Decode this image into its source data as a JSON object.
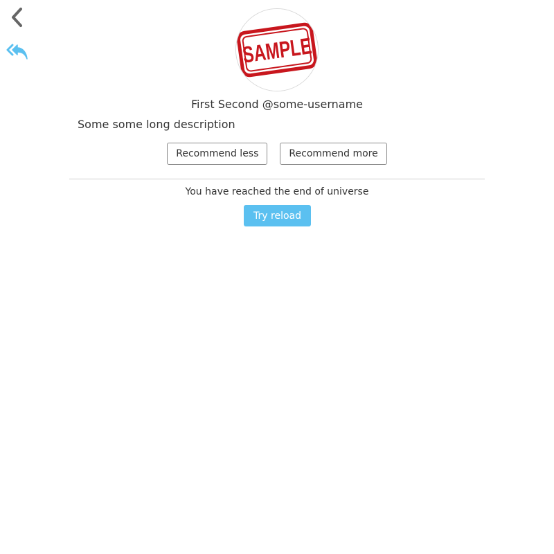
{
  "nav": {
    "back_icon": "chevron-left-icon",
    "reply_all_icon": "reply-all-icon",
    "accent_color": "#5bc0f0"
  },
  "profile": {
    "avatar_stamp_text": "SAMPLE",
    "name_line": "First Second @some-username",
    "description": "Some some long description"
  },
  "actions": {
    "recommend_less_label": "Recommend less",
    "recommend_more_label": "Recommend more"
  },
  "feed_end": {
    "message": "You have reached the end of universe",
    "reload_label": "Try reload",
    "reload_color": "#5bc0f0"
  }
}
